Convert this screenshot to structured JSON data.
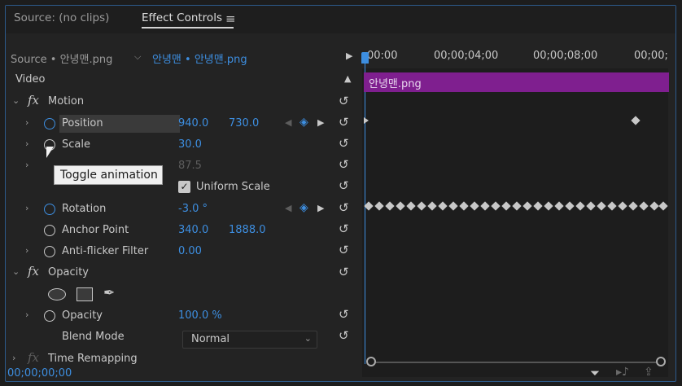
{
  "tabs": {
    "source": "Source: (no clips)",
    "effect_controls": "Effect Controls",
    "menu_icon": "hamburger-menu-icon"
  },
  "source_bar": {
    "source_label": "Source • 안녕맨.png",
    "sequence_label": "안녕맨 • 안녕맨.png",
    "play_icon": "play-icon"
  },
  "timeline": {
    "ticks": [
      "00:00",
      "00;00;04;00",
      "00;00;08;00",
      "00;00;"
    ],
    "clip_label": "안녕맨.png",
    "current_time": "00;00;00;00"
  },
  "section": {
    "video": "Video"
  },
  "motion": {
    "title": "Motion",
    "position": {
      "label": "Position",
      "x": "940.0",
      "y": "730.0"
    },
    "scale": {
      "label": "Scale",
      "value": "30.0"
    },
    "scale_width": {
      "value": "87.5"
    },
    "uniform_scale": "Uniform Scale",
    "rotation": {
      "label": "Rotation",
      "value": "-3.0 °"
    },
    "anchor_point": {
      "label": "Anchor Point",
      "x": "340.0",
      "y": "1888.0"
    },
    "anti_flicker": {
      "label": "Anti-flicker Filter",
      "value": "0.00"
    }
  },
  "opacity": {
    "title": "Opacity",
    "opacity": {
      "label": "Opacity",
      "value": "100.0 %"
    },
    "blend_mode": {
      "label": "Blend Mode",
      "value": "Normal"
    }
  },
  "time_remapping": {
    "title": "Time Remapping"
  },
  "tooltip": "Toggle animation",
  "colors": {
    "accent": "#3d8ee0",
    "clip": "#7f1f8f",
    "border": "#2d5a8c"
  }
}
